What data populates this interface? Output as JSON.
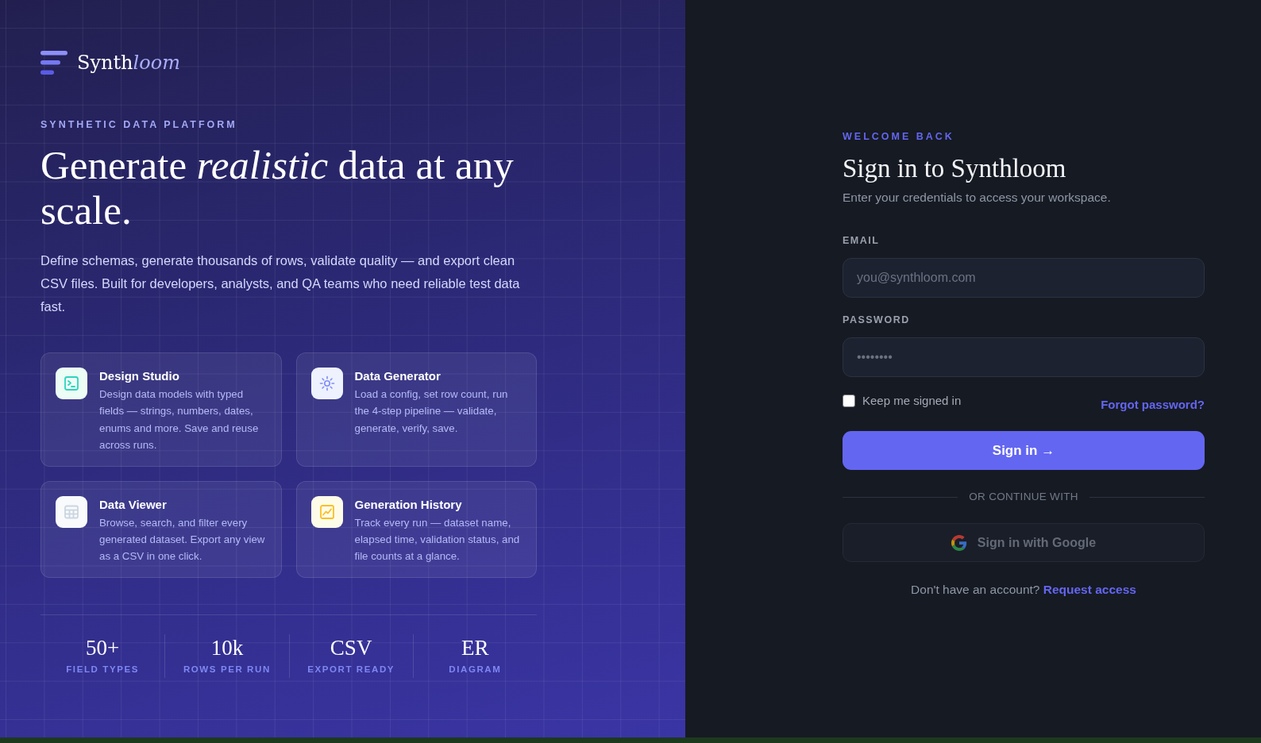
{
  "brand": {
    "name_plain": "Synth",
    "name_italic": "loom"
  },
  "hero": {
    "eyebrow": "SYNTHETIC DATA PLATFORM",
    "title": "Generate *realistic* data at any scale.",
    "description": "Define schemas, generate thousands of rows, validate quality — and export clean CSV files. Built for developers, analysts, and QA teams who need reliable test data fast."
  },
  "features": [
    {
      "kind": "terminal",
      "color": "#ecfdf5",
      "title": "Design Studio",
      "description": "Design data models with typed fields — strings, numbers, dates, enums and more. Save and reuse across runs."
    },
    {
      "kind": "sun",
      "color": "#eef2ff",
      "title": "Data Generator",
      "description": "Load a config, set row count, run the 4-step pipeline — validate, generate, verify, save."
    },
    {
      "kind": "table",
      "color": "#f8fafc",
      "title": "Data Viewer",
      "description": "Browse, search, and filter every generated dataset. Export any view as a CSV in one click."
    },
    {
      "kind": "chart",
      "color": "#fefce8",
      "title": "Generation History",
      "description": "Track every run — dataset name, elapsed time, validation status, and file counts at a glance."
    }
  ],
  "stats": [
    {
      "value": "50+",
      "label": "FIELD TYPES"
    },
    {
      "value": "10k",
      "label": "ROWS PER RUN"
    },
    {
      "value": "CSV",
      "label": "EXPORT READY"
    },
    {
      "value": "ER",
      "label": "DIAGRAM"
    }
  ],
  "signin": {
    "eyebrow": "WELCOME BACK",
    "title": "Sign in to Synthloom",
    "subtitle": "Enter your credentials to access your workspace.",
    "fields": [
      {
        "label": "EMAIL",
        "placeholder": "you@synthloom.com"
      },
      {
        "label": "PASSWORD",
        "placeholder": "••••••••"
      }
    ],
    "remember": {
      "label": "Keep me signed in",
      "checked": false
    },
    "forgot_link": "Forgot password?",
    "submit": "Sign in →",
    "divider": "OR CONTINUE WITH",
    "google": {
      "label": "Sign in with Google",
      "disabled": true
    },
    "footer": {
      "text": "Don't have an account?",
      "link": "Request access"
    }
  }
}
